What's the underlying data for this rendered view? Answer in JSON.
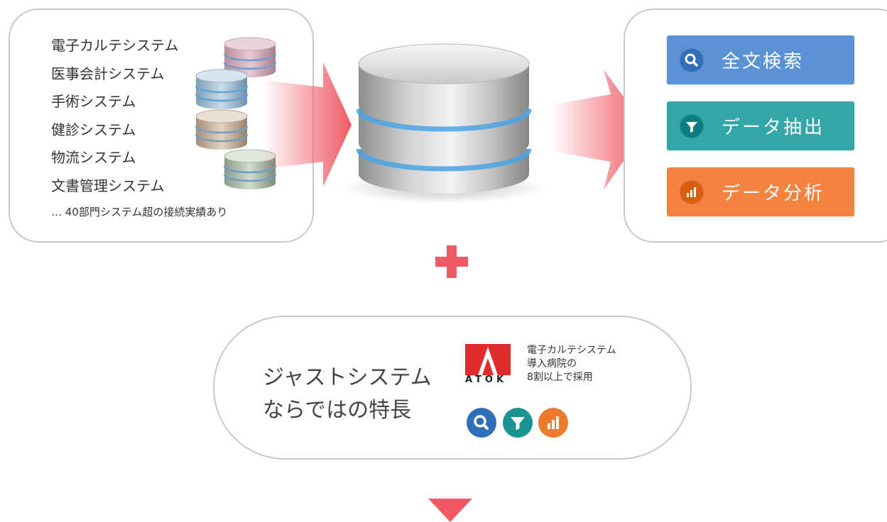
{
  "left_panel": {
    "systems": [
      "電子カルテシステム",
      "医事会計システム",
      "手術システム",
      "健診システム",
      "物流システム",
      "文書管理システム"
    ],
    "more_note": "… 40部門システム超の接続実績あり"
  },
  "features": [
    {
      "label": "全文検索",
      "icon": "search-icon",
      "color": "#5b92d6"
    },
    {
      "label": "データ抽出",
      "icon": "filter-icon",
      "color": "#33a7a8"
    },
    {
      "label": "データ分析",
      "icon": "bar-chart-icon",
      "color": "#f3833f"
    }
  ],
  "colors": {
    "accent_red": "#ef5a63",
    "panel_border": "#c8c8c8"
  },
  "feature_pill": {
    "title_line1": "ジャストシステム",
    "title_line2": "ならではの特長",
    "logo_text": "ATOK",
    "caption_line1": "電子カルテシステム",
    "caption_line2": "導入病院の",
    "caption_line3": "8割以上で採用"
  }
}
